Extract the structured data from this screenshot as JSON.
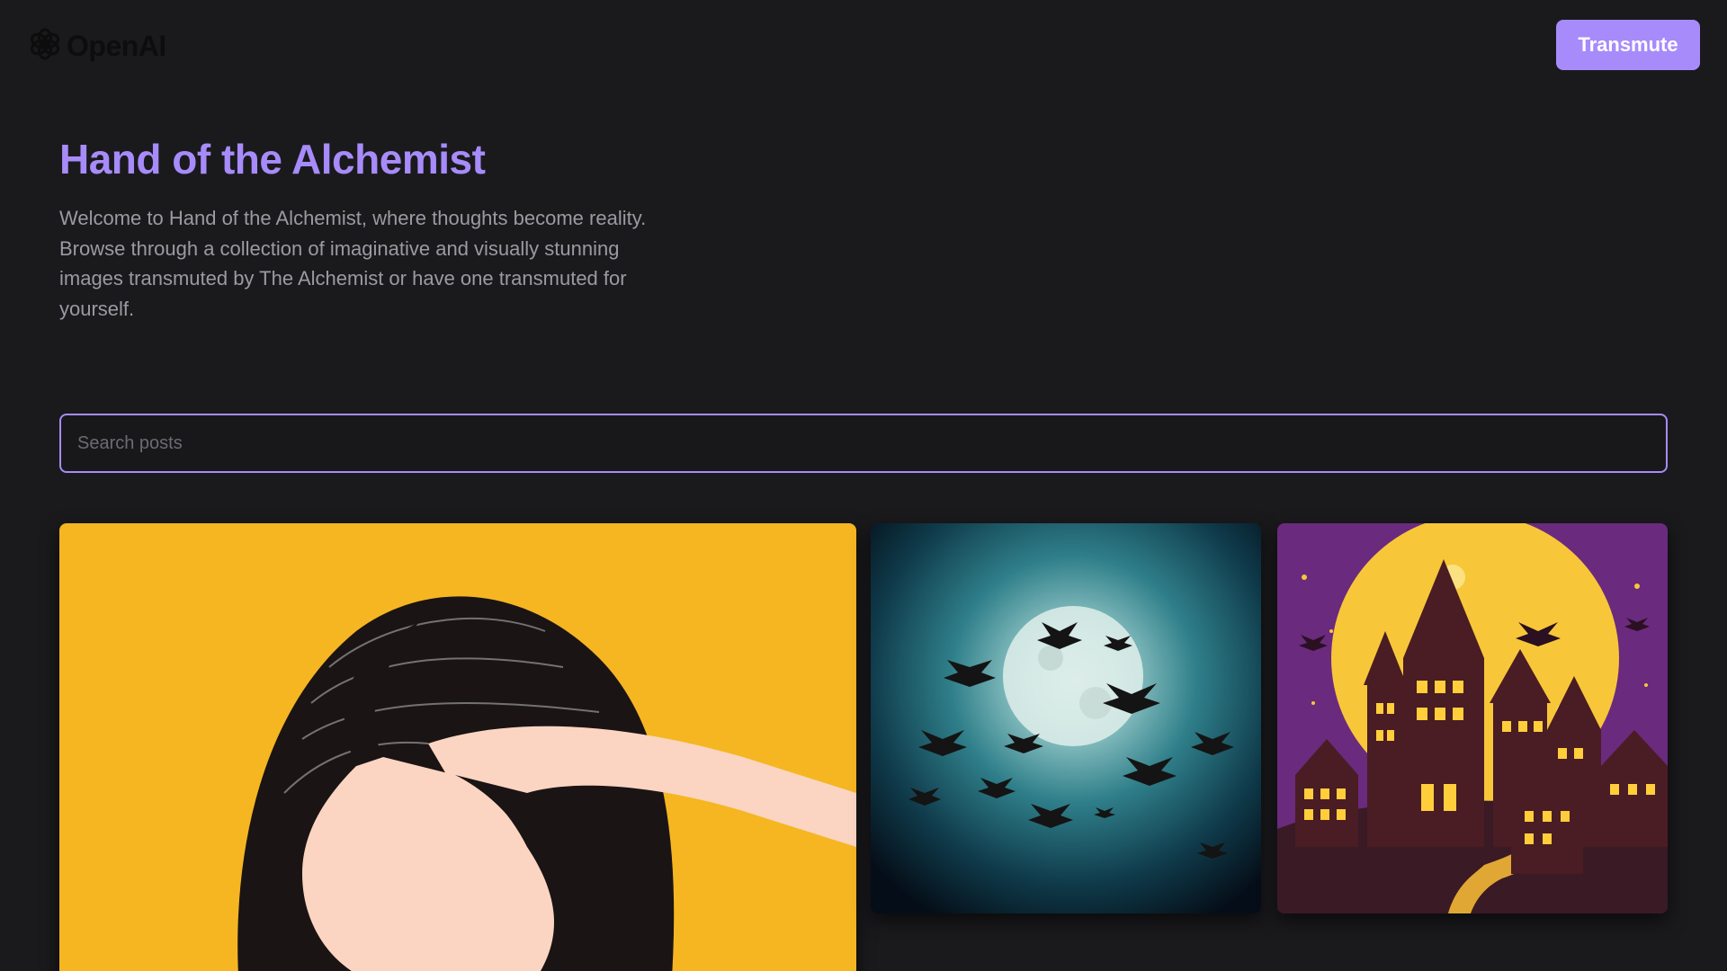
{
  "header": {
    "logo_text": "OpenAI",
    "logo_icon": "openai-logo-icon",
    "cta_label": "Transmute"
  },
  "hero": {
    "title": "Hand of the Alchemist",
    "description": "Welcome to Hand of the Alchemist, where thoughts become reality. Browse through a collection of imaginative and visually stunning images transmuted by The Alchemist or have one transmuted for yourself."
  },
  "search": {
    "placeholder": "Search posts",
    "value": ""
  },
  "gallery": {
    "items": [
      {
        "subject": "woman-pointing-illustration",
        "background": "#f5b622"
      },
      {
        "subject": "bats-and-full-moon",
        "background": "#0d2a34"
      },
      {
        "subject": "halloween-town-with-moon",
        "background": "#6a2a7e"
      }
    ]
  },
  "colors": {
    "background": "#1a1a1d",
    "accent": "#a78bfa",
    "muted_text": "#9a9aa2"
  }
}
